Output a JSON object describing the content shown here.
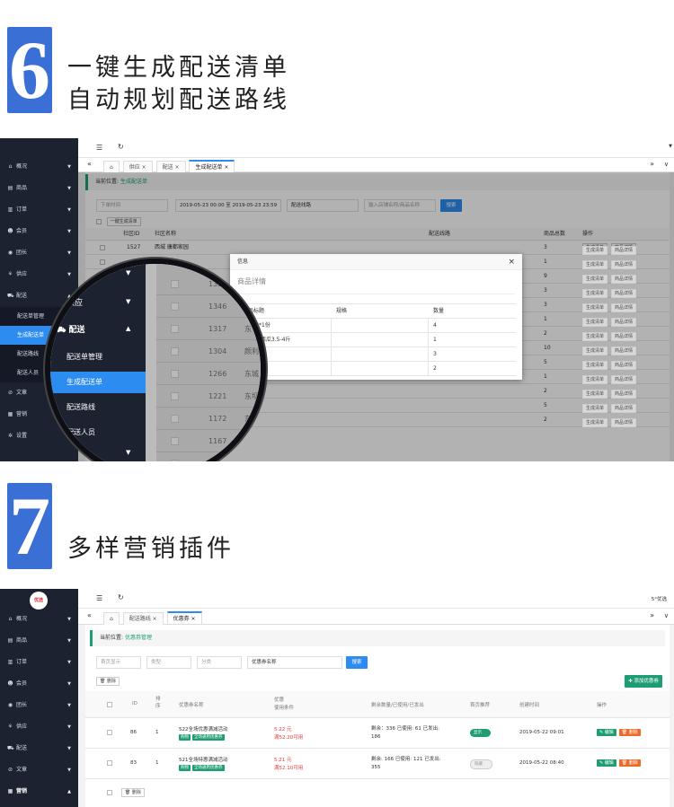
{
  "section6": {
    "number": "6",
    "line1": "一键生成配送清单",
    "line2": "自动规划配送路线"
  },
  "section7": {
    "number": "7",
    "line1": "多样营销插件"
  },
  "s1": {
    "sidebar": [
      {
        "icon": "⌂",
        "label": "概况"
      },
      {
        "icon": "▤",
        "label": "商品"
      },
      {
        "icon": "▥",
        "label": "订单"
      },
      {
        "icon": "☻",
        "label": "会员"
      },
      {
        "icon": "◉",
        "label": "团长"
      },
      {
        "icon": "⚘",
        "label": "供应"
      },
      {
        "icon": "⛟",
        "label": "配送"
      }
    ],
    "sidebar_sub": [
      "配送单管理",
      "生成配送单",
      "配送路线",
      "配送人员"
    ],
    "sidebar_bottom": [
      {
        "icon": "⊘",
        "label": "文章"
      },
      {
        "icon": "▦",
        "label": "营销"
      },
      {
        "icon": "✲",
        "label": "设置"
      }
    ],
    "tabs": [
      "供应",
      "配送",
      "生成配送单"
    ],
    "crumb_prefix": "当前位置:",
    "crumb_page": "生成配送单",
    "filter_time": "下单时间",
    "date_range": "2019-05-23 00:00 至 2019-05-23 23:59",
    "route": "配送线路",
    "search_ph": "输入店铺名称/商品名称",
    "search_btn": "搜索",
    "gen_btn": "一键生成清单",
    "headers": {
      "id": "社区ID",
      "name": "社区名称",
      "route": "配送线路",
      "total": "商品总数",
      "op": "操作"
    },
    "first_row": {
      "id": "1527",
      "name": "西城 康都家园",
      "total": "3"
    },
    "totals": [
      "3",
      "1",
      "9",
      "3",
      "3",
      "1",
      "2",
      "10",
      "5",
      "1",
      "2",
      "5",
      "2"
    ],
    "op1": "生成清单",
    "op2": "商品详情",
    "modal": {
      "title": "信息",
      "close": "×",
      "subtitle": "商品详情",
      "cols": [
        "商品标题",
        "规格",
        "数量"
      ],
      "rows": [
        [
          "鸡翅中*1份",
          "",
          "4"
        ],
        [
          "东北 红西瓜3.5-4斤",
          "",
          "1"
        ],
        [
          "草莓*1斤",
          "",
          "3"
        ],
        [
          "",
          "",
          "2"
        ]
      ]
    },
    "zoom": {
      "menu_above": "供应",
      "menu_head": "配送",
      "menu_items": [
        "配送单管理",
        "生成配送单",
        "配送路线",
        "配送人员"
      ],
      "ids": [
        "1356",
        "1346",
        "1317",
        "1304",
        "1266",
        "1221",
        "1172",
        "1167",
        "1161"
      ],
      "names": [
        "",
        "",
        "东",
        "颜利",
        "东城",
        "东坝",
        "东",
        "",
        ""
      ]
    }
  },
  "s2": {
    "logo": "优选",
    "sidebar": [
      {
        "icon": "⌂",
        "label": "概况"
      },
      {
        "icon": "▤",
        "label": "商品"
      },
      {
        "icon": "▥",
        "label": "订单"
      },
      {
        "icon": "☻",
        "label": "会员"
      },
      {
        "icon": "◉",
        "label": "团长"
      },
      {
        "icon": "⚘",
        "label": "供应"
      },
      {
        "icon": "⛟",
        "label": "配送"
      },
      {
        "icon": "⊘",
        "label": "文章"
      },
      {
        "icon": "▦",
        "label": "营销"
      }
    ],
    "top_right": "5°优选",
    "tabs": [
      "配送路线",
      "优惠券"
    ],
    "crumb_prefix": "当前位置:",
    "crumb_page": "优惠券管理",
    "filter1": "首页显示",
    "filter2": "类型",
    "filter3": "分类",
    "name_ph": "优惠券名称",
    "search_btn": "搜索",
    "add_btn": "添加优惠券",
    "del_btn": "删除",
    "headers": {
      "id": "ID",
      "sort": "排序",
      "name": "优惠券名称",
      "cond1": "优惠",
      "cond2": "使用条件",
      "stock": "剩余数量/已使用/已发出",
      "home": "首页推荐",
      "created": "创建时间",
      "op": "操作"
    },
    "rows": [
      {
        "id": "86",
        "sort": "1",
        "name": "522全场优惠满减活动",
        "tag1": "购物",
        "tag2": "全场通用优惠券",
        "amount": "5.22 元",
        "cond": "满52.20可用",
        "stock": "剩余：336 已使用: 61 已发出: 186",
        "home": "显示",
        "home_on": true,
        "created": "2019-05-22 09:01"
      },
      {
        "id": "83",
        "sort": "1",
        "name": "521全场特惠满减活动",
        "tag1": "购物",
        "tag2": "全场通用优惠券",
        "amount": "5.21 元",
        "cond": "满52.10可用",
        "stock": "剩余: 166 已使用: 121 已发出: 355",
        "home": "隐藏",
        "home_on": false,
        "created": "2019-05-22 08:40"
      }
    ],
    "edit": "编辑",
    "delete": "删除"
  }
}
